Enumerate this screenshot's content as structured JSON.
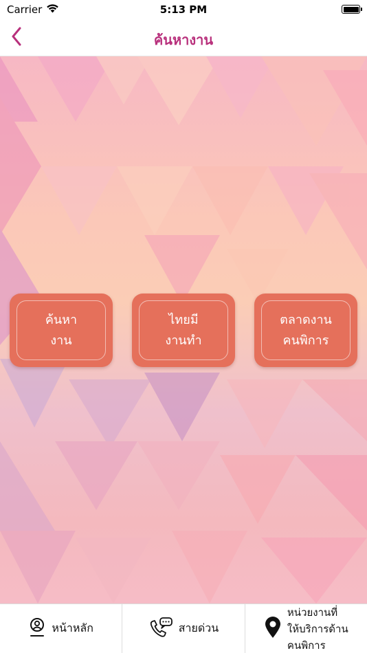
{
  "status_bar": {
    "carrier": "Carrier",
    "time": "5:13 PM",
    "icons": [
      "wifi-icon",
      "battery-icon"
    ]
  },
  "nav": {
    "title": "ค้นหางาน",
    "back_icon": "chevron-left-icon",
    "accent_color": "#b8307c"
  },
  "menu": {
    "tile_color": "#e5705b",
    "tiles": [
      {
        "line1": "ค้นหา",
        "line2": "งาน"
      },
      {
        "line1": "ไทยมี",
        "line2": "งานทำ"
      },
      {
        "line1": "ตลาดงาน",
        "line2": "คนพิการ"
      }
    ]
  },
  "tab_bar": {
    "tabs": [
      {
        "icon": "person-icon",
        "label": "หน้าหลัก"
      },
      {
        "icon": "phone-chat-icon",
        "label": "สายด่วน"
      },
      {
        "icon": "location-pin-icon",
        "line1": "หน่วยงานที่",
        "line2": "ให้บริการด้าน",
        "line3": "คนพิการ"
      }
    ]
  }
}
